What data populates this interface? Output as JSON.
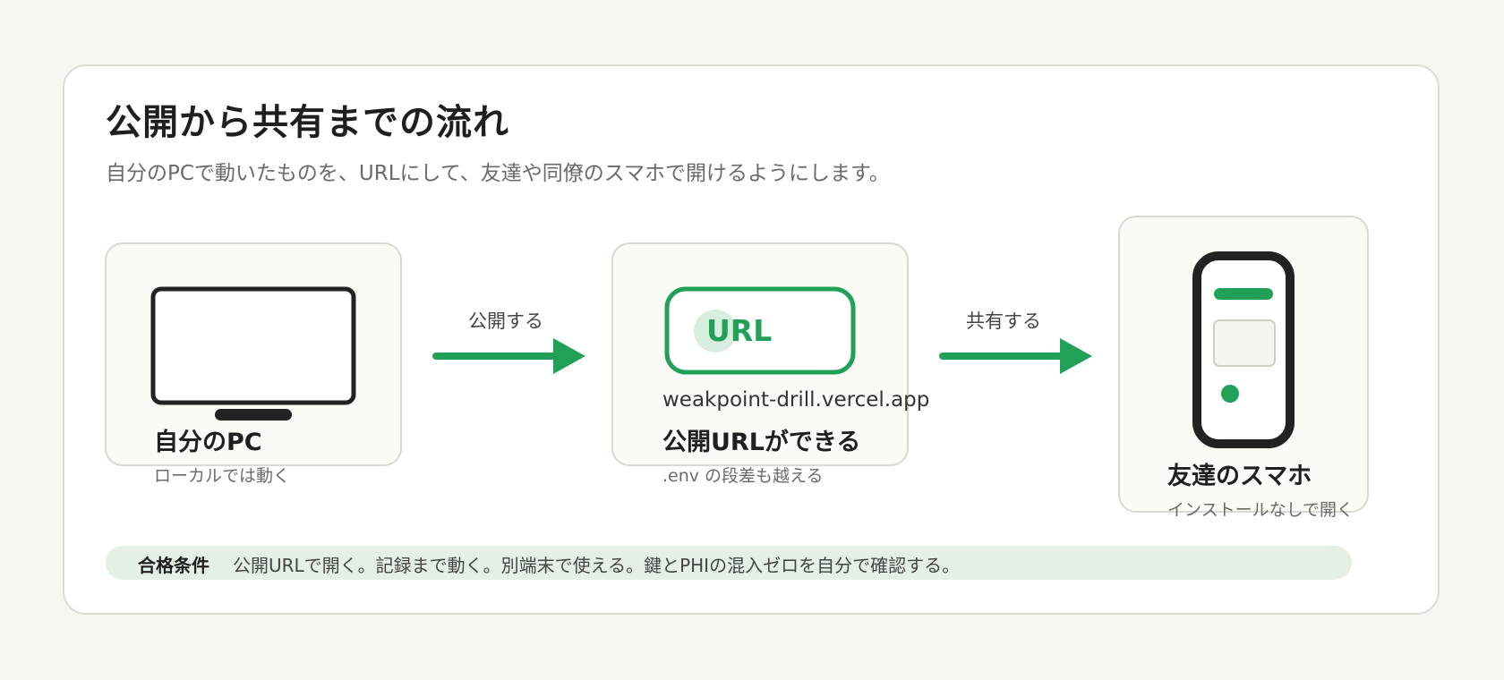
{
  "title": "公開から共有までの流れ",
  "subtitle": "自分のPCで動いたものを、URLにして、友達や同僚のスマホで開けるようにします。",
  "steps": [
    {
      "label": "自分のPC",
      "sub": "ローカルでは動く",
      "icon": "monitor-icon"
    },
    {
      "label": "公開URLができる",
      "sub": ".env の段差も越える",
      "icon": "url-badge-icon",
      "badge_text": "URL",
      "domain": "weakpoint-drill.vercel.app"
    },
    {
      "label": "友達のスマホ",
      "sub": "インストールなしで開く",
      "icon": "smartphone-icon"
    }
  ],
  "arrows": [
    {
      "label": "公開する"
    },
    {
      "label": "共有する"
    }
  ],
  "condition": {
    "label": "合格条件",
    "text": "公開URLで開く。記録まで動く。別端末で使える。鍵とPHIの混入ゼロを自分で確認する。"
  },
  "colors": {
    "accent": "#22a057",
    "accent_light": "#d7eddf",
    "condition_bg": "#e4f0e6",
    "icon_dark": "#222222"
  }
}
